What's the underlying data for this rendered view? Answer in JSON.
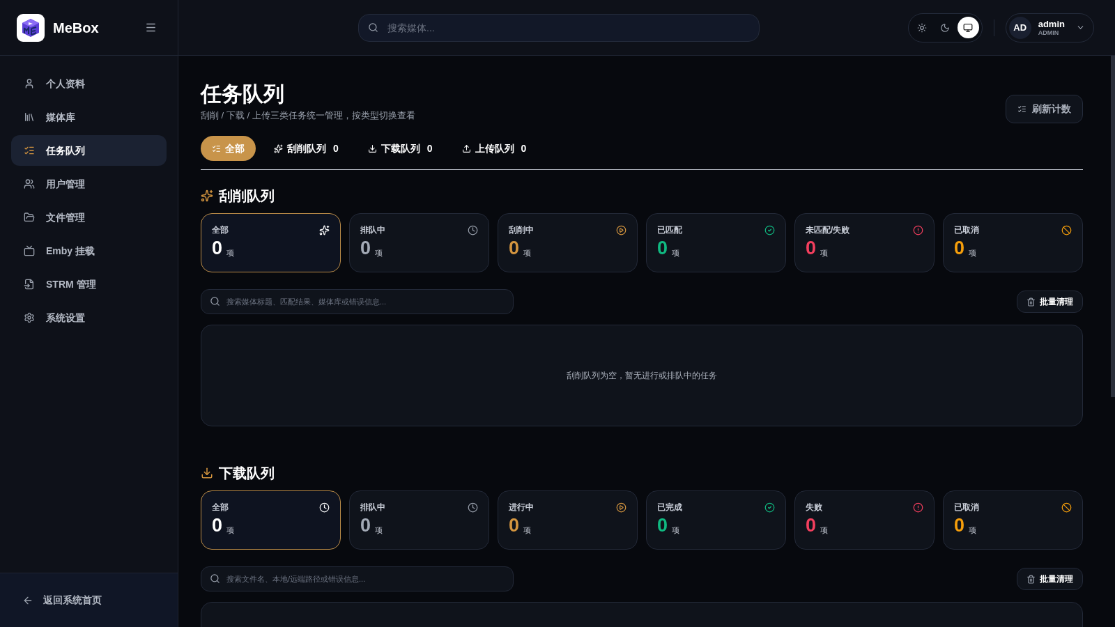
{
  "brand": {
    "name": "MeBox"
  },
  "sidebar": {
    "items": [
      {
        "label": "个人资料",
        "selected": false
      },
      {
        "label": "媒体库",
        "selected": false
      },
      {
        "label": "任务队列",
        "selected": true
      },
      {
        "label": "用户管理",
        "selected": false
      },
      {
        "label": "文件管理",
        "selected": false
      },
      {
        "label": "Emby 挂载",
        "selected": false
      },
      {
        "label": "STRM 管理",
        "selected": false
      },
      {
        "label": "系统设置",
        "selected": false
      }
    ],
    "footer": "返回系统首页"
  },
  "header": {
    "search": {
      "placeholder": "搜索媒体..."
    },
    "theme_options": [
      {
        "kind": "light",
        "selected": false
      },
      {
        "kind": "dark",
        "selected": false
      },
      {
        "kind": "system",
        "selected": true
      }
    ],
    "user": {
      "initials": "AD",
      "name": "admin",
      "role": "ADMIN"
    }
  },
  "page": {
    "title": "任务队列",
    "subtitle": "刮削 / 下载 / 上传三类任务统一管理，按类型切换查看",
    "refresh_button": "刷新计数"
  },
  "tabs": [
    {
      "kind": "all",
      "label": "全部",
      "selected": true
    },
    {
      "kind": "scrape",
      "label": "刮削队列",
      "count": "0",
      "selected": false
    },
    {
      "kind": "download",
      "label": "下载队列",
      "count": "0",
      "selected": false
    },
    {
      "kind": "upload",
      "label": "上传队列",
      "count": "0",
      "selected": false
    }
  ],
  "queues": [
    {
      "kind": "scrape",
      "title": "刮削队列",
      "stats": [
        {
          "kind": "all",
          "label": "全部",
          "value": "0",
          "unit": "项",
          "color": "#ffffff",
          "selected": true
        },
        {
          "kind": "queued",
          "label": "排队中",
          "value": "0",
          "unit": "项",
          "color": "#a3aab6",
          "selected": false
        },
        {
          "kind": "running",
          "label": "刮削中",
          "value": "0",
          "unit": "项",
          "color": "#d4953f",
          "selected": false
        },
        {
          "kind": "done",
          "label": "已匹配",
          "value": "0",
          "unit": "项",
          "color": "#10b981",
          "selected": false
        },
        {
          "kind": "failed",
          "label": "未匹配/失败",
          "value": "0",
          "unit": "项",
          "color": "#f43f5e",
          "selected": false
        },
        {
          "kind": "cancelled",
          "label": "已取消",
          "value": "0",
          "unit": "项",
          "color": "#f59e0b",
          "selected": false
        }
      ],
      "search": {
        "placeholder": "搜索媒体标题、匹配结果、媒体库或错误信息..."
      },
      "clear_button": "批量清理",
      "empty_message": "刮削队列为空，暂无进行或排队中的任务"
    },
    {
      "kind": "download",
      "title": "下载队列",
      "stats": [
        {
          "kind": "all",
          "label": "全部",
          "value": "0",
          "unit": "项",
          "color": "#ffffff",
          "selected": true
        },
        {
          "kind": "queued",
          "label": "排队中",
          "value": "0",
          "unit": "项",
          "color": "#a3aab6",
          "selected": false
        },
        {
          "kind": "running",
          "label": "进行中",
          "value": "0",
          "unit": "项",
          "color": "#d4953f",
          "selected": false
        },
        {
          "kind": "done",
          "label": "已完成",
          "value": "0",
          "unit": "项",
          "color": "#10b981",
          "selected": false
        },
        {
          "kind": "failed",
          "label": "失败",
          "value": "0",
          "unit": "项",
          "color": "#f43f5e",
          "selected": false
        },
        {
          "kind": "cancelled",
          "label": "已取消",
          "value": "0",
          "unit": "项",
          "color": "#f59e0b",
          "selected": false
        }
      ],
      "search": {
        "placeholder": "搜索文件名、本地/远端路径或错误信息..."
      },
      "clear_button": "批量清理"
    }
  ]
}
